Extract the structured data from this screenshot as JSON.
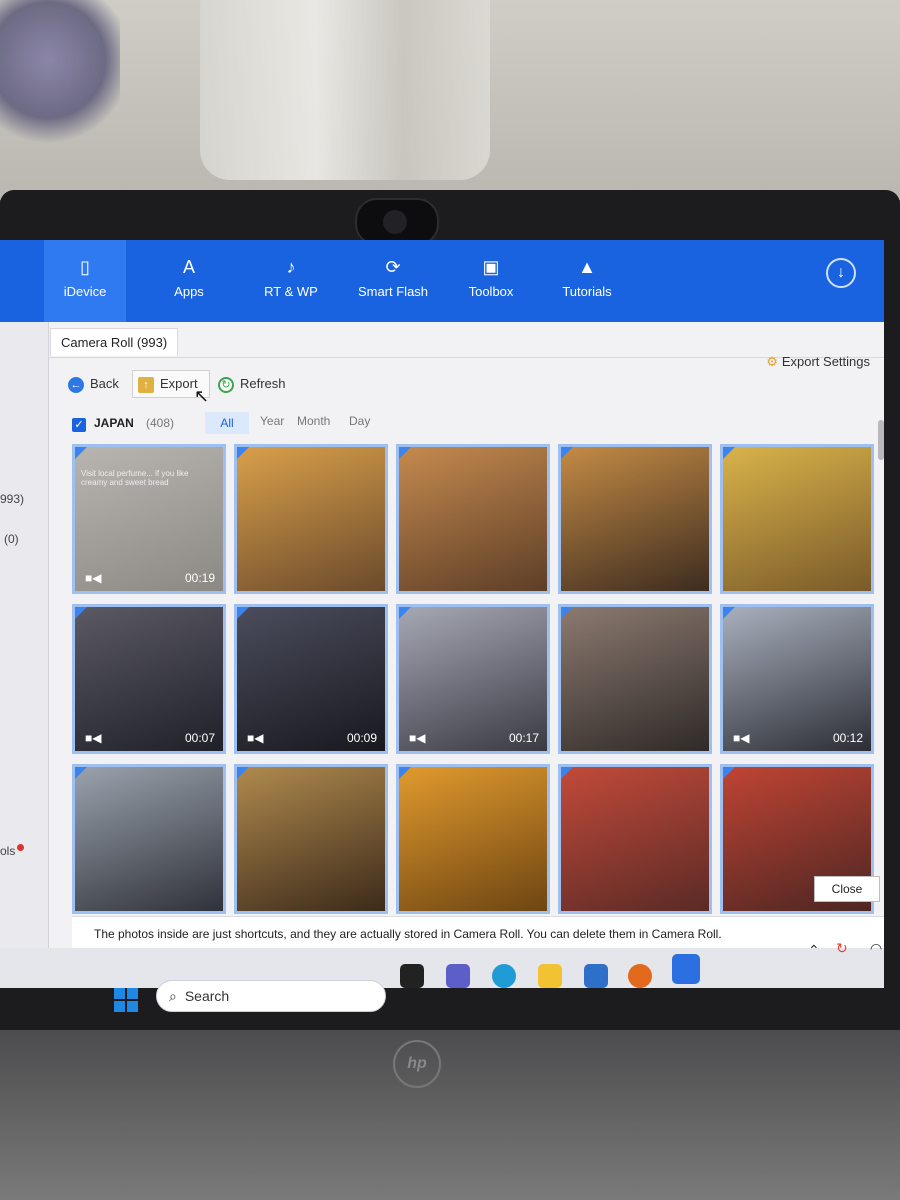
{
  "nav": {
    "items": [
      {
        "label": "iDevice",
        "icon": "phone-icon",
        "active": true
      },
      {
        "label": "Apps",
        "icon": "app-store-icon"
      },
      {
        "label": "RT & WP",
        "icon": "music-note-icon"
      },
      {
        "label": "Smart Flash",
        "icon": "flash-icon"
      },
      {
        "label": "Toolbox",
        "icon": "toolbox-icon"
      },
      {
        "label": "Tutorials",
        "icon": "graduation-cap-icon"
      }
    ],
    "download_icon": "download-icon"
  },
  "left_panel": {
    "items": [
      "993)",
      "(0)",
      "ols"
    ]
  },
  "tab": {
    "label": "Camera Roll (993)"
  },
  "toolbar": {
    "back_label": "Back",
    "export_label": "Export",
    "refresh_label": "Refresh",
    "export_settings_label": "Export Settings"
  },
  "filter": {
    "album_name": "JAPAN",
    "album_count": "(408)",
    "options": [
      "All",
      "Year",
      "Month",
      "Day"
    ],
    "selected": "All"
  },
  "thumbnails": [
    {
      "type": "video",
      "duration": "00:19",
      "caption": "Visit local perfume...\nif you like creamy and sweet bread",
      "colors": [
        "#b8b5b0",
        "#8c8884"
      ]
    },
    {
      "type": "photo",
      "duration": "",
      "caption": "",
      "colors": [
        "#d9a04a",
        "#6b4a2c"
      ]
    },
    {
      "type": "photo",
      "duration": "",
      "caption": "",
      "colors": [
        "#c58a4f",
        "#5d3e27"
      ]
    },
    {
      "type": "photo",
      "duration": "",
      "caption": "",
      "colors": [
        "#c48b45",
        "#3d2c20"
      ]
    },
    {
      "type": "photo",
      "duration": "",
      "caption": "",
      "colors": [
        "#d9b34a",
        "#7a5a2a"
      ]
    },
    {
      "type": "video",
      "duration": "00:07",
      "caption": "",
      "colors": [
        "#5b5a64",
        "#202028"
      ]
    },
    {
      "type": "video",
      "duration": "00:09",
      "caption": "",
      "colors": [
        "#4b4d5d",
        "#18181e"
      ]
    },
    {
      "type": "video",
      "duration": "00:17",
      "caption": "",
      "colors": [
        "#a6a8b4",
        "#3a3a44"
      ]
    },
    {
      "type": "photo",
      "duration": "",
      "caption": "",
      "colors": [
        "#8c7a70",
        "#2f2a28"
      ]
    },
    {
      "type": "video",
      "duration": "00:12",
      "caption": "",
      "colors": [
        "#a9b0bd",
        "#2c2e36"
      ]
    },
    {
      "type": "photo",
      "duration": "",
      "caption": "",
      "colors": [
        "#9aa2ad",
        "#30323a"
      ]
    },
    {
      "type": "photo",
      "duration": "",
      "caption": "",
      "colors": [
        "#b08a4e",
        "#3c2a1a"
      ]
    },
    {
      "type": "photo",
      "duration": "",
      "caption": "",
      "colors": [
        "#e19a2e",
        "#6e4512"
      ]
    },
    {
      "type": "photo",
      "duration": "",
      "caption": "",
      "colors": [
        "#c24a3a",
        "#5a2a26"
      ]
    },
    {
      "type": "photo",
      "duration": "",
      "caption": "",
      "colors": [
        "#c04434",
        "#4c2622"
      ]
    }
  ],
  "notice": {
    "text": "The photos inside are just shortcuts, and they are actually stored in Camera Roll. You can delete them in Camera Roll.",
    "close_label": "Close"
  },
  "taskbar": {
    "search_placeholder": "Search",
    "app_icons": [
      "task-view-icon",
      "video-call-icon",
      "edge-icon",
      "file-explorer-icon",
      "mail-icon",
      "firefox-icon",
      "3utools-icon"
    ]
  },
  "colors": {
    "brand_blue": "#1a63e0",
    "selection_blue": "#9ec0f0"
  }
}
